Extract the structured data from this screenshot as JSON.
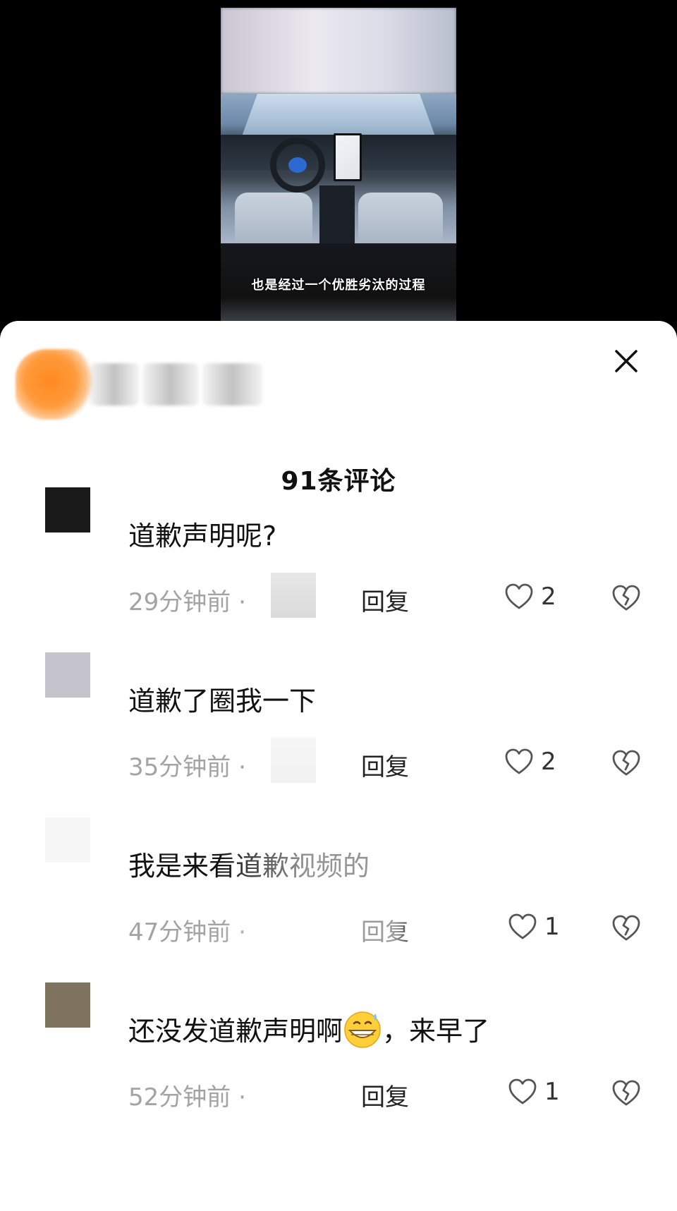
{
  "video": {
    "caption": "也是经过一个优胜劣汰的过程"
  },
  "sheet": {
    "comment_count_title": "91条评论",
    "reply_label": "回复",
    "comments": [
      {
        "text": "道歉声明呢?",
        "time": "29分钟前 ·",
        "likes": "2",
        "avatar_color": "#1a1a1a"
      },
      {
        "text": "道歉了圈我一下",
        "time": "35分钟前 ·",
        "likes": "2",
        "avatar_color": "#c5c4cc"
      },
      {
        "text": "我是来看道歉视频的",
        "time": "47分钟前 ·",
        "likes": "1",
        "avatar_color": "#f6f6f6"
      },
      {
        "text_before": "还没发道歉声明啊",
        "emoji": "grinning-sweat-emoji",
        "text_after": "，来早了",
        "time": "52分钟前 ·",
        "likes": "1",
        "avatar_color": "#7e735f"
      }
    ]
  },
  "icons": {
    "close": "close-icon",
    "like": "heart-icon",
    "dislike": "broken-heart-icon"
  }
}
